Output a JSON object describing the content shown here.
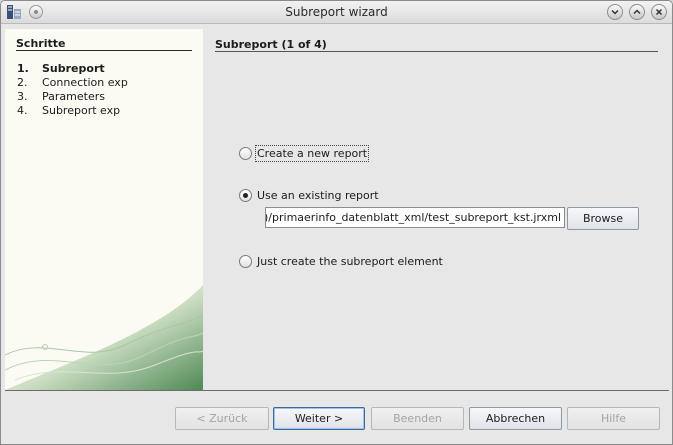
{
  "window": {
    "title": "Subreport wizard",
    "controls": [
      "minimize-icon",
      "maximize-icon",
      "close-icon"
    ]
  },
  "steps": {
    "header": "Schritte",
    "items": [
      {
        "num": "1.",
        "label": "Subreport",
        "active": true
      },
      {
        "num": "2.",
        "label": "Connection exp",
        "active": false
      },
      {
        "num": "3.",
        "label": "Parameters",
        "active": false
      },
      {
        "num": "4.",
        "label": "Subreport exp",
        "active": false
      }
    ]
  },
  "content": {
    "title": "Subreport (1 of 4)",
    "options": {
      "create_new": {
        "label": "Create a new report",
        "checked": false
      },
      "use_existing": {
        "label": "Use an existing report",
        "checked": true
      },
      "just_element": {
        "label": "Just create the subreport element",
        "checked": false
      }
    },
    "report_path": ")/primaerinfo_datenblatt_xml/test_subreport_kst.jrxml",
    "browse_label": "Browse"
  },
  "footer": {
    "back": {
      "label": "< Zurück",
      "enabled": false
    },
    "next": {
      "label": "Weiter >",
      "enabled": true
    },
    "finish": {
      "label": "Beenden",
      "enabled": false
    },
    "cancel": {
      "label": "Abbrechen",
      "enabled": true
    },
    "help": {
      "label": "Hilfe",
      "enabled": false
    }
  }
}
